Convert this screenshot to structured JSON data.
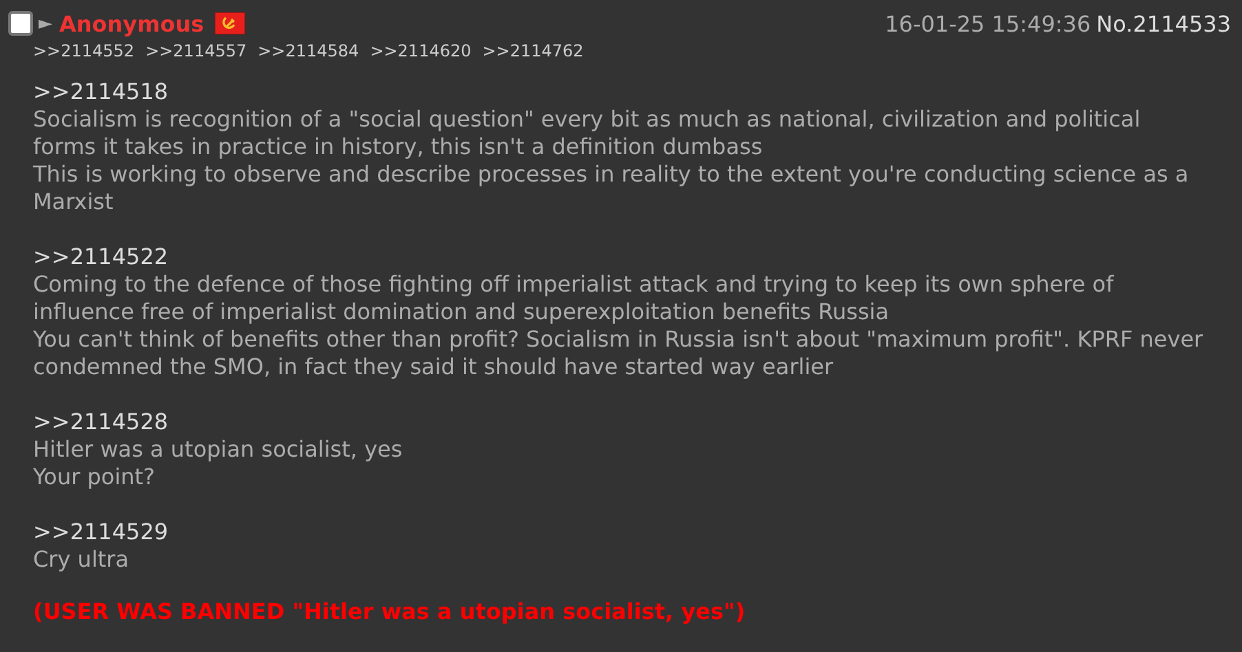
{
  "post": {
    "selected": false,
    "arrow": "►",
    "name": "Anonymous",
    "datetime": "16-01-25 15:49:36",
    "number": "No.2114533",
    "replies": [
      ">>2114552",
      ">>2114557",
      ">>2114584",
      ">>2114620",
      ">>2114762"
    ],
    "body": [
      {
        "quote": ">>2114518",
        "lines": [
          "Socialism is recognition of a \"social question\" every bit as much as national, civilization and political forms it takes in practice in history, this isn't a definition dumbass",
          "This is working to observe and describe processes in reality to the extent you're conducting science as a Marxist"
        ]
      },
      {
        "quote": ">>2114522",
        "lines": [
          "Coming to the defence of those fighting off imperialist attack and trying to keep its own sphere of influence free of imperialist domination and superexploitation benefits Russia",
          "You can't think of benefits other than profit? Socialism in Russia isn't about \"maximum profit\". KPRF never condemned the SMO, in fact they said it should have started way earlier"
        ]
      },
      {
        "quote": ">>2114528",
        "lines": [
          "Hitler was a utopian socialist, yes",
          "Your point?"
        ]
      },
      {
        "quote": ">>2114529",
        "lines": [
          "Cry ultra"
        ]
      }
    ],
    "ban_message": "(USER WAS BANNED \"Hitler was a utopian socialist, yes\")"
  }
}
